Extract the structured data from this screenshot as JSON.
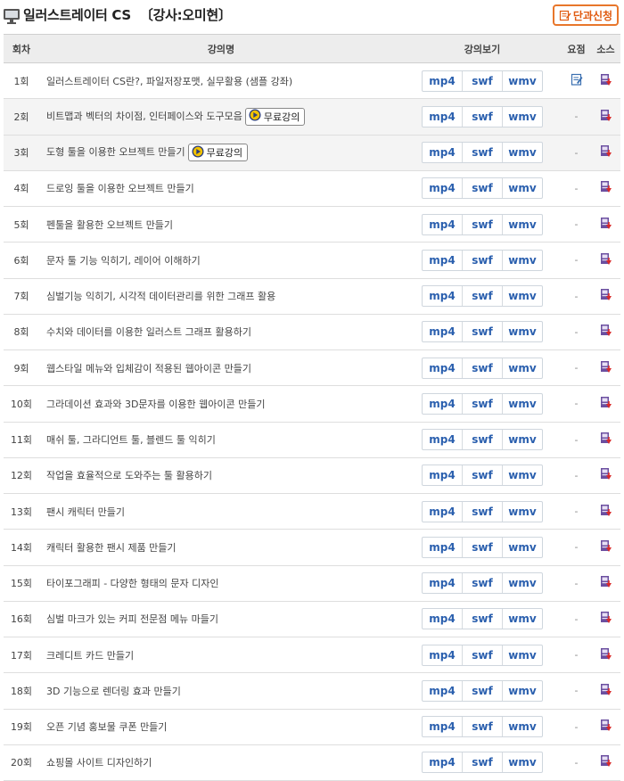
{
  "header": {
    "title": "일러스트레이터 CS",
    "instructor": "〔강사:오미현〕",
    "apply_button": "단과신청"
  },
  "table": {
    "columns": {
      "num": "회차",
      "name": "강의명",
      "view": "강의보기",
      "summary": "요점",
      "source": "소스"
    },
    "format_labels": [
      "mp4",
      "swf",
      "wmv"
    ],
    "free_label": "무료강의",
    "summary_dash": "-",
    "rows": [
      {
        "num": "1회",
        "name": "일러스트레이터 CS란?, 파일저장포맷, 실무활용 (샘플 강좌)",
        "free": false,
        "summary": "note-icon"
      },
      {
        "num": "2회",
        "name": "비트맵과 벡터의 차이점, 인터페이스와 도구모음",
        "free": true,
        "summary": "-"
      },
      {
        "num": "3회",
        "name": "도형 툴을 이용한 오브젝트 만들기",
        "free": true,
        "summary": "-"
      },
      {
        "num": "4회",
        "name": "드로잉 툴을 이용한 오브젝트 만들기",
        "free": false,
        "summary": "-"
      },
      {
        "num": "5회",
        "name": "펜툴을 활용한 오브젝트 만들기",
        "free": false,
        "summary": "-"
      },
      {
        "num": "6회",
        "name": "문자 툴 기능 익히기, 레이어 이해하기",
        "free": false,
        "summary": "-"
      },
      {
        "num": "7회",
        "name": "심벌기능 익히기, 시각적 데이터관리를 위한 그래프 활용",
        "free": false,
        "summary": "-"
      },
      {
        "num": "8회",
        "name": "수치와 데이터를 이용한 일러스트 그래프 활용하기",
        "free": false,
        "summary": "-"
      },
      {
        "num": "9회",
        "name": "웹스타일 메뉴와 입체감이 적용된 웹아이콘 만들기",
        "free": false,
        "summary": "-"
      },
      {
        "num": "10회",
        "name": "그라데이션 효과와 3D문자를 이용한 웹아이콘 만들기",
        "free": false,
        "summary": "-"
      },
      {
        "num": "11회",
        "name": "매쉬 툴, 그라디언트 툴, 블렌드 툴 익히기",
        "free": false,
        "summary": "-"
      },
      {
        "num": "12회",
        "name": "작업을 효율적으로 도와주는 툴 활용하기",
        "free": false,
        "summary": "-"
      },
      {
        "num": "13회",
        "name": "팬시 캐릭터 만들기",
        "free": false,
        "summary": "-"
      },
      {
        "num": "14회",
        "name": "캐릭터 활용한 팬시 제품 만들기",
        "free": false,
        "summary": "-"
      },
      {
        "num": "15회",
        "name": "타이포그래피 - 다양한 형태의 문자 디자인",
        "free": false,
        "summary": "-"
      },
      {
        "num": "16회",
        "name": "심벌 마크가 있는 커피 전문점 메뉴 마들기",
        "free": false,
        "summary": "-"
      },
      {
        "num": "17회",
        "name": "크레디트 카드 만들기",
        "free": false,
        "summary": "-"
      },
      {
        "num": "18회",
        "name": "3D 기능으로 렌더링 효과 만들기",
        "free": false,
        "summary": "-"
      },
      {
        "num": "19회",
        "name": "오픈 기념 홍보물 쿠폰 만들기",
        "free": false,
        "summary": "-"
      },
      {
        "num": "20회",
        "name": "쇼핑몰 사이트 디자인하기",
        "free": false,
        "summary": "-"
      }
    ]
  },
  "colors": {
    "accent": "#e8762b",
    "format_text": "#2a5fae",
    "row_shade": "#f4f4f4",
    "header_bg": "#ededed"
  }
}
